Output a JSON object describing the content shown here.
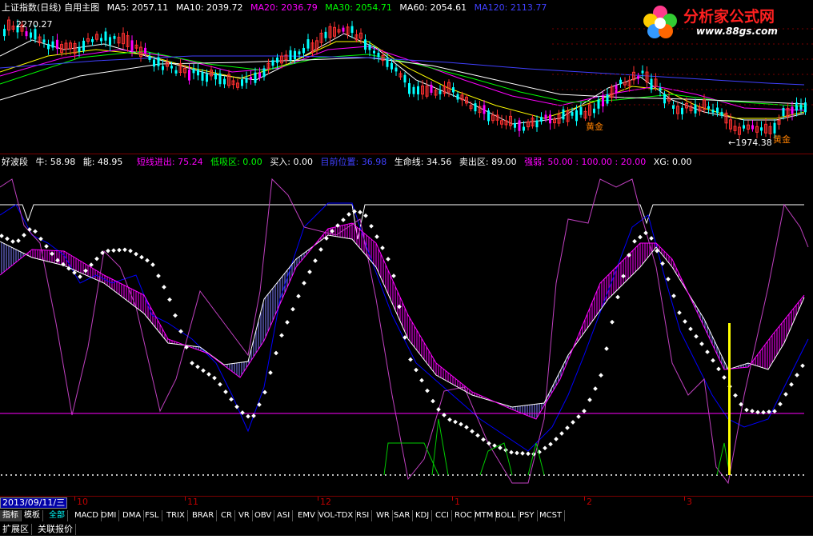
{
  "main_header": {
    "title": "上证指数(日线) 自用主图",
    "ma5": "MA5: 2057.11",
    "ma10": "MA10: 2039.72",
    "ma20": "MA20: 2036.79",
    "ma30": "MA30: 2054.71",
    "ma60": "MA60: 2054.61",
    "ma120": "MA120: 2113.77"
  },
  "main_labels": {
    "high": "2270.27",
    "low": "←1974.38",
    "tag1": "黄金",
    "tag2": "黄金"
  },
  "logo": {
    "name": "分析家公式网",
    "url": "www.88gs.com"
  },
  "ind_header": {
    "name": "好波段",
    "niu": "牛: 58.98",
    "neng": "能: 48.95",
    "dx": "短线进出: 75.24",
    "dxq": "低吸区: 0.00",
    "buy": "买入: 0.00",
    "pos": "目前位置: 36.98",
    "life": "生命线: 34.56",
    "sell": "卖出区: 89.00",
    "strong": "强弱: 50.00 : 100.00 : 20.00",
    "xg": "XG: 0.00"
  },
  "date_axis": {
    "current": "2013/09/11/三",
    "months": [
      "10",
      "11",
      "12",
      "1",
      "2",
      "3"
    ]
  },
  "tabs": [
    "指标",
    "模板",
    "全部",
    "MACD",
    "DMI",
    "DMA",
    "FSL",
    "TRIX",
    "BRAR",
    "CR",
    "VR",
    "OBV",
    "ASI",
    "EMV",
    "VOL-TDX",
    "RSI",
    "WR",
    "SAR",
    "KDJ",
    "CCI",
    "ROC",
    "MTM",
    "BOLL",
    "PSY",
    "MCST"
  ],
  "bottom_tabs": [
    "扩展区",
    "关联报价"
  ],
  "colors": {
    "ma5": "#ffffff",
    "ma10": "#ffff00",
    "ma20": "#ff00ff",
    "ma30": "#00ff00",
    "ma60": "#ffffff",
    "ma120": "#4040ff",
    "up": "#ff3030",
    "down": "#00ffff",
    "axis": "#c00000",
    "border": "#7a0000",
    "purple": "#ff00ff",
    "blue": "#0000ff"
  }
}
